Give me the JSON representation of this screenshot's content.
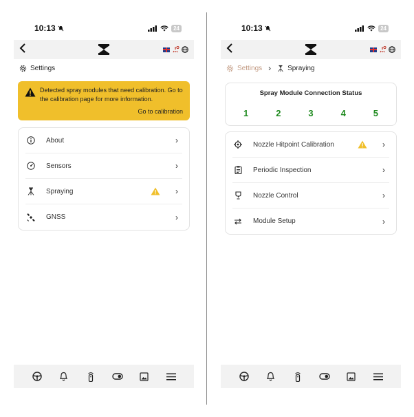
{
  "colors": {
    "warning_bg": "#f0bf2b",
    "module_ok": "#1f8a1f",
    "crumb_muted": "#c29a82"
  },
  "left": {
    "status_bar": {
      "time": "10:13",
      "battery": "24"
    },
    "breadcrumb": {
      "settings": "Settings"
    },
    "warning": {
      "text": "Detected spray modules that need calibration. Go to the calibration page for more information.",
      "link": "Go to calibration"
    },
    "menu": [
      {
        "label": "About",
        "icon": "info-icon"
      },
      {
        "label": "Sensors",
        "icon": "gauge-icon"
      },
      {
        "label": "Spraying",
        "icon": "spray-nozzle-icon",
        "warning": true
      },
      {
        "label": "GNSS",
        "icon": "satellite-icon"
      }
    ]
  },
  "right": {
    "status_bar": {
      "time": "10:13",
      "battery": "24"
    },
    "breadcrumb": {
      "settings": "Settings",
      "current": "Spraying"
    },
    "connection": {
      "title": "Spray Module Connection Status",
      "modules": [
        "1",
        "2",
        "3",
        "4",
        "5"
      ]
    },
    "menu": [
      {
        "label": "Nozzle Hitpoint Calibration",
        "icon": "crosshair-icon",
        "warning": true
      },
      {
        "label": "Periodic Inspection",
        "icon": "clipboard-icon"
      },
      {
        "label": "Nozzle Control",
        "icon": "nozzle-icon"
      },
      {
        "label": "Module Setup",
        "icon": "swap-arrows-icon"
      }
    ]
  },
  "tabbar": [
    "steering-wheel-icon",
    "bell-icon",
    "remote-icon",
    "toggle-icon",
    "image-icon",
    "menu-icon"
  ]
}
